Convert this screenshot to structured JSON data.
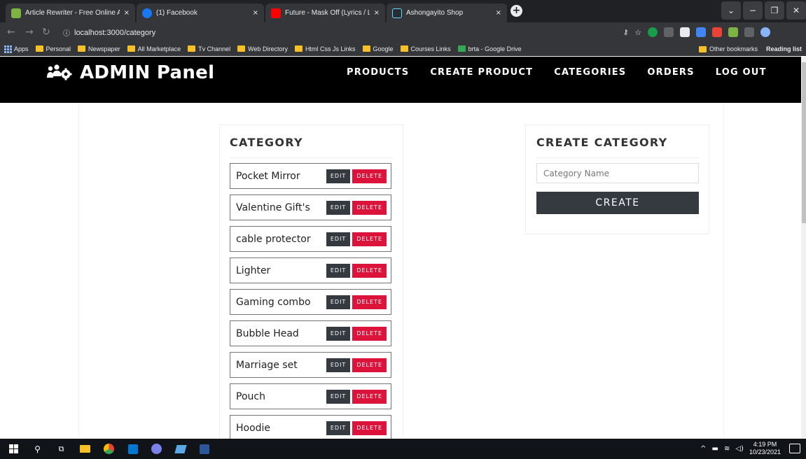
{
  "browser": {
    "tabs": [
      {
        "title": "Article Rewriter - Free Online Arti",
        "favicon_color": "#7cb342"
      },
      {
        "title": "(1) Facebook",
        "favicon_color": "#1877f2"
      },
      {
        "title": "Future - Mask Off (Lyrics / Lyric V",
        "favicon_color": "#ff0000"
      },
      {
        "title": "Ashongayito Shop",
        "favicon_color": "#61dafb"
      }
    ],
    "tab_close": "×",
    "new_tab": "+",
    "url": "localhost:3000/category",
    "bookmarks": [
      "Apps",
      "Personal",
      "Newspaper",
      "All Marketplace",
      "Tv Channel",
      "Web Directory",
      "Html Css Js Links",
      "Google",
      "Courses Links",
      "brta - Google Drive"
    ],
    "bookmarks_right": [
      "Other bookmarks",
      "Reading list"
    ]
  },
  "header": {
    "brand": "ADMIN Panel",
    "nav": [
      "PRODUCTS",
      "CREATE PRODUCT",
      "CATEGORIES",
      "ORDERS",
      "LOG OUT"
    ]
  },
  "category_list": {
    "title": "CATEGORY",
    "edit_label": "EDIT",
    "delete_label": "DELETE",
    "items": [
      "Pocket Mirror",
      "Valentine Gift's",
      "cable protector",
      "Lighter",
      "Gaming combo",
      "Bubble Head",
      "Marriage set",
      "Pouch",
      "Hoodie"
    ]
  },
  "create_category": {
    "title": "CREATE CATEGORY",
    "placeholder": "Category Name",
    "button": "CREATE"
  },
  "taskbar": {
    "time": "4:19 PM",
    "date": "10/23/2021"
  },
  "colors": {
    "header_bg": "#000000",
    "edit_bg": "#343a40",
    "delete_bg": "#dc143c"
  }
}
